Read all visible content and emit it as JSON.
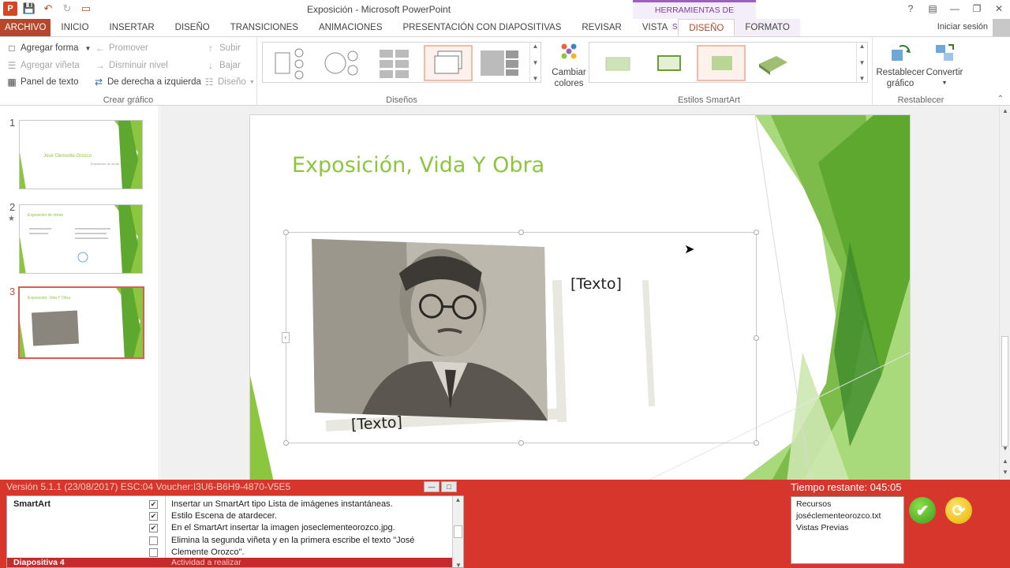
{
  "window": {
    "title": "Exposición - Microsoft PowerPoint",
    "contextual_group": "HERRAMIENTAS DE SMARTART",
    "signin": "Iniciar sesión"
  },
  "tabs": [
    {
      "label": "ARCHIVO"
    },
    {
      "label": "INICIO"
    },
    {
      "label": "INSERTAR"
    },
    {
      "label": "DISEÑO"
    },
    {
      "label": "TRANSICIONES"
    },
    {
      "label": "ANIMACIONES"
    },
    {
      "label": "PRESENTACIÓN CON DIAPOSITIVAS"
    },
    {
      "label": "REVISAR"
    },
    {
      "label": "VISTA"
    },
    {
      "label": "DISEÑO"
    },
    {
      "label": "FORMATO"
    }
  ],
  "ribbon": {
    "crear_grafico": {
      "label": "Crear gráfico",
      "agregar_forma": "Agregar forma",
      "agregar_vineta": "Agregar viñeta",
      "panel_texto": "Panel de texto",
      "promover": "Promover",
      "disminuir": "Disminuir nivel",
      "derecha_izquierda": "De derecha a izquierda",
      "subir": "Subir",
      "bajar": "Bajar",
      "diseno": "Diseño"
    },
    "disenos": {
      "label": "Diseños"
    },
    "estilos": {
      "label": "Estilos SmartArt",
      "cambiar_colores": "Cambiar colores"
    },
    "restablecer": {
      "label": "Restablecer",
      "restablecer_grafico": "Restablecer gráfico",
      "convertir": "Convertir"
    }
  },
  "slides": [
    {
      "number": "1",
      "title": "José Clemente Orozco",
      "subtitle": "Exposición de obras"
    },
    {
      "number": "2",
      "title": "Exposición de obras"
    },
    {
      "number": "3",
      "title": "Exposición, Vida Y Obra"
    }
  ],
  "current_slide": {
    "title": "Exposición, Vida Y Obra",
    "placeholder_right": "[Texto]",
    "placeholder_bottom": "[Texto]"
  },
  "exam": {
    "version": "Versión 5.1.1  (23/08/2017)  ESC:04  Voucher:I3U6-B6H9-4870-V5E5",
    "timer": "Tiempo restante: 045:05",
    "category": "SmartArt",
    "tasks": [
      {
        "checked": true,
        "text": "Insertar un SmartArt tipo Lista de imágenes instantáneas."
      },
      {
        "checked": true,
        "text": "Estilo Escena de atardecer."
      },
      {
        "checked": true,
        "text": "En el SmartArt insertar la imagen joseclementeorozco.jpg."
      },
      {
        "checked": false,
        "text": "Elimina la segunda viñeta y en la primera escribe  el texto \"José"
      },
      {
        "checked": false,
        "text": "Clemente Orozco\"."
      }
    ],
    "footer_left": "Diapositiva 4",
    "footer_right": "Actividad a realizar",
    "resources": [
      "Recursos",
      "joséclementeorozco.txt",
      "Vistas Previas"
    ]
  },
  "colors": {
    "accent": "#b7472a",
    "title_green": "#8cc63f",
    "exam_red": "#d6362b",
    "contextual": "#7b3fa0"
  }
}
